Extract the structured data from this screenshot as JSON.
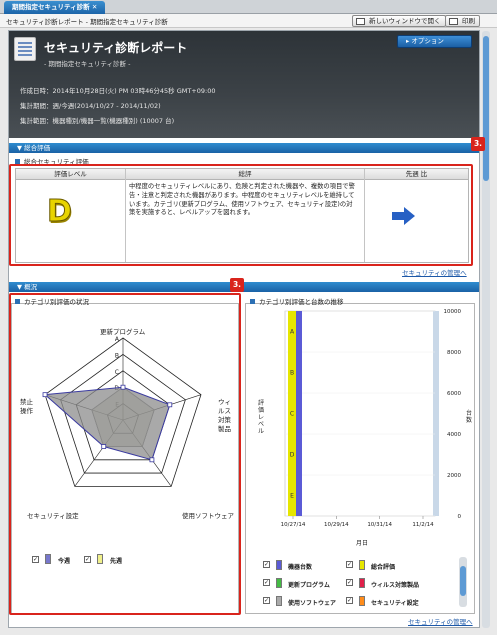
{
  "tab": {
    "label": "期間指定セキュリティ診断"
  },
  "breadcrumb": "セキュリティ診断レポート - 期間指定セキュリティ診断",
  "toolbar": {
    "new_window": "新しいウィンドウで開く",
    "print": "印刷"
  },
  "header": {
    "title": "セキュリティ診断レポート",
    "subtitle": "- 期間指定セキュリティ診断 -",
    "option_button": "オプション",
    "created_label": "作成日時：",
    "created_value": "2014年10月28日(火) PM 03時46分45秒 GMT+09:00",
    "period_label": "集計期間：",
    "period_value": "週/今週(2014/10/27 - 2014/11/02)",
    "scope_label": "集計範囲：",
    "scope_value": "機器種別/機器一覧(機器種別) (10007 台)"
  },
  "summary": {
    "section": "総合評価",
    "subsection": "総合セキュリティ評価",
    "col_level": "評価レベル",
    "col_comment": "総評",
    "col_compare": "先週 比",
    "grade": "D",
    "comment": "中程度のセキュリティレベルにあり、危険と判定された機器や、複数の項目で警告・注意と判定された機器があります。中程度のセキュリティレベルを維持しています。カテゴリ(更新プログラム、使用ソフトウェア、セキュリティ設定)の対策を実施すると、レベルアップを図れます。",
    "badge": "3.",
    "link": "セキュリティの管理へ"
  },
  "overview": {
    "section": "概況",
    "radar_title": "カテゴリ別評価の状況",
    "trend_title": "カテゴリ別評価と台数の推移",
    "badge": "3.",
    "link": "セキュリティの管理へ",
    "legend_radar": [
      {
        "label": "今週",
        "checked": true,
        "color": "#7777cc"
      },
      {
        "label": "先週",
        "checked": true,
        "color": "#f0f08a"
      }
    ],
    "legend_trend": [
      {
        "label": "機器台数",
        "color": "#5b5bd6"
      },
      {
        "label": "総合評価",
        "color": "#e6e600"
      },
      {
        "label": "更新プログラム",
        "color": "#44bb44"
      },
      {
        "label": "ウィルス対策製品",
        "color": "#e0204a"
      },
      {
        "label": "使用ソフトウェア",
        "color": "#aaaaaa"
      },
      {
        "label": "セキュリティ設定",
        "color": "#ff8c1a"
      }
    ]
  },
  "chart_data": [
    {
      "type": "radar",
      "title": "カテゴリ別評価の状況",
      "axes": [
        "更新プログラム",
        "ウィルス対策製品",
        "使用ソフトウェア",
        "セキュリティ設定",
        "禁止操作"
      ],
      "scale": [
        "A",
        "B",
        "C",
        "D",
        "E"
      ],
      "series": [
        {
          "name": "今週",
          "values": [
            "D",
            "C",
            "C",
            "D",
            "A"
          ]
        },
        {
          "name": "先週",
          "values": [
            "D",
            "D",
            "D",
            "D",
            "D"
          ]
        }
      ]
    },
    {
      "type": "bar",
      "title": "カテゴリ別評価と台数の推移",
      "xlabel": "月日",
      "ylabel": "評価レベル",
      "y2label": "台数",
      "x_ticks": [
        "10/27/14",
        "10/29/14",
        "10/31/14",
        "11/2/14"
      ],
      "y_ticks": [
        "A",
        "B",
        "C",
        "D",
        "E"
      ],
      "y2_ticks": [
        0,
        2000,
        4000,
        6000,
        8000,
        10000
      ],
      "series": [
        {
          "name": "総合評価",
          "values": [
            "D"
          ]
        },
        {
          "name": "機器台数",
          "values": [
            10007
          ]
        }
      ]
    }
  ]
}
